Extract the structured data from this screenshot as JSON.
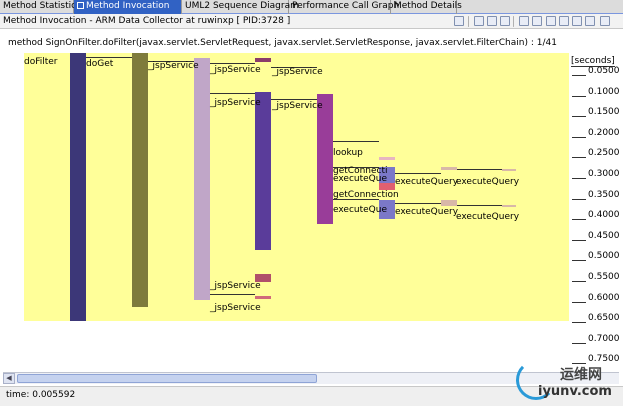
{
  "tabs": [
    {
      "label": "Method Statistics",
      "active": false
    },
    {
      "label": "Method Invocation",
      "active": true
    },
    {
      "label": "UML2 Sequence Diagram",
      "active": false
    },
    {
      "label": "Performance Call Graph",
      "active": false
    },
    {
      "label": "Method Details",
      "active": false
    }
  ],
  "view": {
    "title": "Method Invocation - ARM Data Collector at ruwinxp [ PID:3728 ]"
  },
  "method_header": "method SignOnFilter.doFilter(javax.servlet.ServletRequest, javax.servlet.ServletResponse, javax.servlet.FilterChain)  : 1/41",
  "axis": {
    "unit": "[seconds]",
    "ticks": [
      "0.0500",
      "0.1000",
      "0.1500",
      "0.2000",
      "0.2500",
      "0.3000",
      "0.3500",
      "0.4000",
      "0.4500",
      "0.5000",
      "0.5500",
      "0.6000",
      "0.6500",
      "0.7000",
      "0.7500"
    ]
  },
  "invocations": [
    {
      "label": "doFilter"
    },
    {
      "label": "doGet"
    },
    {
      "label": "_jspService"
    },
    {
      "label": "_jspService"
    },
    {
      "label": "_jspService"
    },
    {
      "label": "_jspService"
    },
    {
      "label": "_jspService"
    },
    {
      "label": "_jspService"
    },
    {
      "label": "lookup"
    },
    {
      "label": "getConnecti"
    },
    {
      "label": "executeQue"
    },
    {
      "label": "getConnection"
    },
    {
      "label": "executeQue"
    },
    {
      "label": "executeQuery"
    },
    {
      "label": "executeQuery"
    },
    {
      "label": "executeQuery"
    },
    {
      "label": "executeQuery"
    }
  ],
  "colors": {
    "plot_bg": "#ffff99",
    "doFilter": "#3c3778",
    "doGet": "#7e7b3c",
    "jspService": "#c0a6c8",
    "jspService_inner": "#5a3c9a",
    "jspService_deep": "#993d99",
    "executeQuery": "#7b78c8",
    "accent_red": "#c0505a"
  },
  "status": {
    "time": "time: 0.005592"
  },
  "watermark": {
    "cn": "运维网",
    "url": "iyunv.com"
  }
}
